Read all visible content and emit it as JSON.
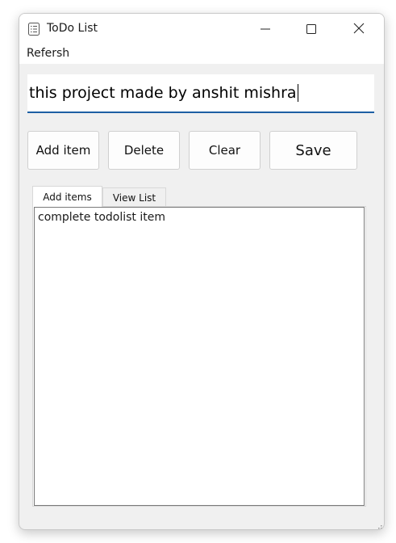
{
  "window": {
    "title": "ToDo List",
    "app_icon": "list-icon",
    "controls": [
      "minimize-icon",
      "maximize-icon",
      "close-icon"
    ]
  },
  "menu": {
    "items": [
      {
        "label": "Refersh"
      }
    ]
  },
  "input": {
    "value": "this project made by anshit mishra",
    "focus_color": "#1d5fa4"
  },
  "buttons": {
    "add": "Add item",
    "delete": "Delete",
    "clear": "Clear",
    "save": "Save"
  },
  "tabs": [
    {
      "label": "Add items",
      "active": true
    },
    {
      "label": "View List",
      "active": false
    }
  ],
  "list": {
    "items": [
      "complete todolist item"
    ]
  }
}
